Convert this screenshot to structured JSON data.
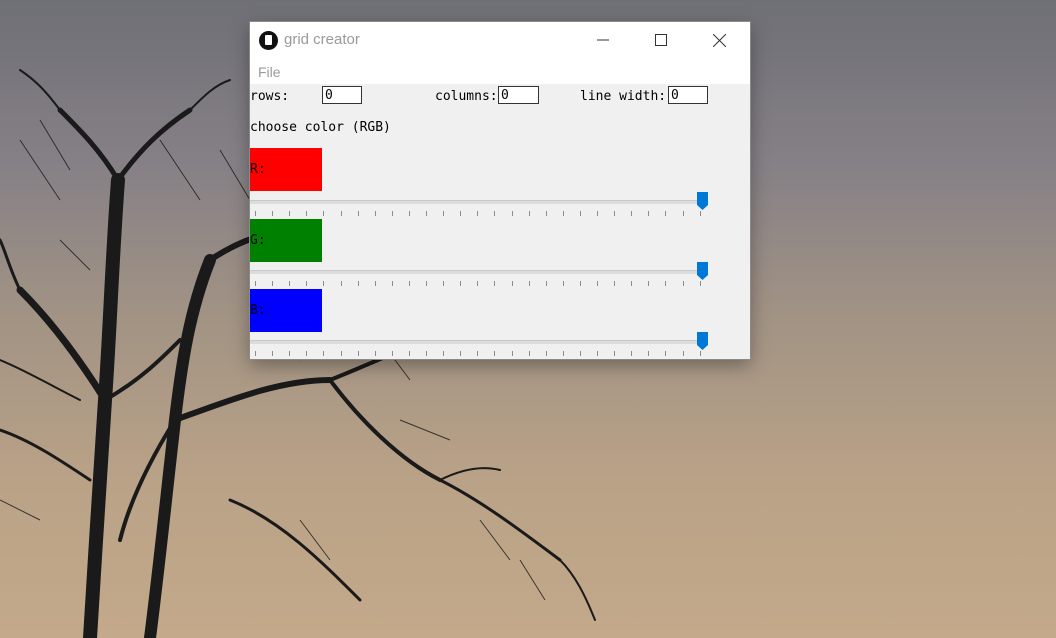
{
  "window": {
    "title": "grid creator"
  },
  "menu": {
    "file": "File"
  },
  "form": {
    "rows_label": "rows:",
    "rows_value": "0",
    "columns_label": "columns:",
    "columns_value": "0",
    "line_width_label": "line width:",
    "line_width_value": "0",
    "choose_color_label": "choose color (RGB)"
  },
  "channels": [
    {
      "label": "R:",
      "color": "#ff0000",
      "slider_level": 1.0
    },
    {
      "label": "G:",
      "color": "#008000",
      "slider_level": 1.0
    },
    {
      "label": "B:",
      "color": "#0000ff",
      "slider_level": 1.0
    }
  ],
  "accent_color": "#0078d7"
}
